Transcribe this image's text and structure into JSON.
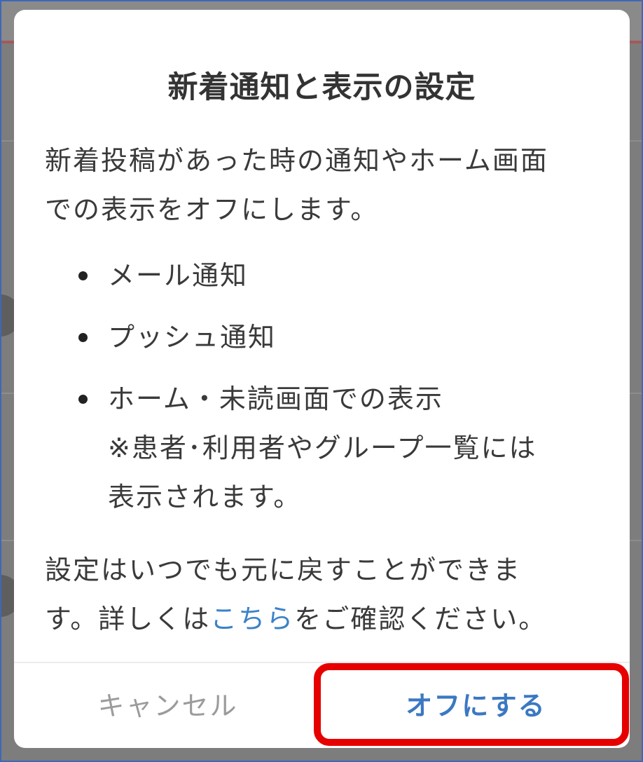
{
  "modal": {
    "title": "新着通知と表示の設定",
    "intro_line1": "新着投稿があった時の通知やホーム画面",
    "intro_line2": "での表示をオフにします。",
    "bullets": [
      {
        "text": "メール通知"
      },
      {
        "text": "プッシュ通知"
      },
      {
        "text": "ホーム・未読画面での表示",
        "note_line1": "※患者･利用者やグループ一覧には",
        "note_line2": "表示されます。"
      }
    ],
    "footer_line1": "設定はいつでも元に戻すことができま",
    "footer_line2_prefix": "す。詳しくは",
    "footer_link": "こちら",
    "footer_line2_suffix": "をご確認ください。",
    "cancel_label": "キャンセル",
    "confirm_label": "オフにする"
  },
  "colors": {
    "link": "#3b82c8",
    "confirm": "#3b78c2",
    "cancel": "#9b9b9b",
    "highlight": "#e60000",
    "frame": "#3d67b8"
  }
}
